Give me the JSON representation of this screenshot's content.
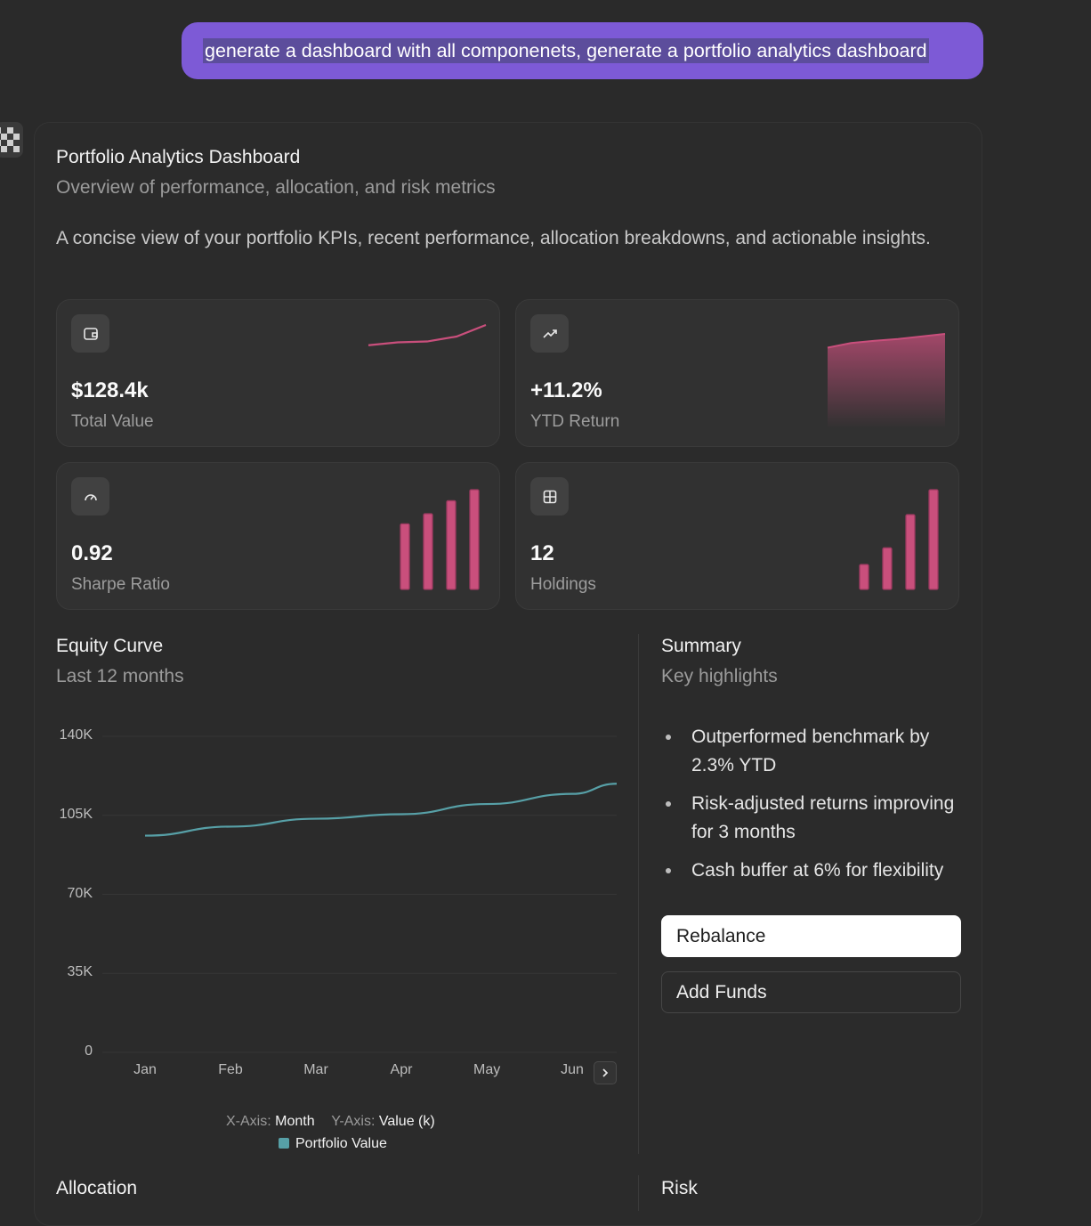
{
  "chat": {
    "user_message": "generate a dashboard with all componenets, generate a portfolio analytics dashboard"
  },
  "dashboard": {
    "title": "Portfolio Analytics Dashboard",
    "subtitle": "Overview of performance, allocation, and risk metrics",
    "description": "A concise view of your portfolio KPIs, recent performance, allocation breakdowns, and actionable insights.",
    "kpis": [
      {
        "value": "$128.4k",
        "label": "Total Value",
        "icon": "wallet-icon",
        "spark_type": "line",
        "spark": [
          1,
          2,
          2.3,
          4,
          8
        ]
      },
      {
        "value": "+11.2%",
        "label": "YTD Return",
        "icon": "trending-up-icon",
        "spark_type": "area",
        "spark": [
          5.5,
          6.8,
          7.4,
          7.9,
          8.6,
          9.3
        ]
      },
      {
        "value": "0.92",
        "label": "Sharpe Ratio",
        "icon": "gauge-icon",
        "spark_type": "bar",
        "spark": [
          0.71,
          0.82,
          0.96,
          1.08
        ]
      },
      {
        "value": "12",
        "label": "Holdings",
        "icon": "grid-icon",
        "spark_type": "bar",
        "spark": [
          3,
          5,
          9,
          12
        ]
      }
    ],
    "accent_color": "#c94f7c",
    "line_color": "#57a0a7"
  },
  "equity": {
    "title": "Equity Curve",
    "subtitle": "Last 12 months",
    "legend_x_key": "X-Axis:",
    "legend_x_val": "Month",
    "legend_y_key": "Y-Axis:",
    "legend_y_val": "Value (k)",
    "series_name": "Portfolio Value"
  },
  "chart_data": {
    "type": "line",
    "categories": [
      "Jan",
      "Feb",
      "Mar",
      "Apr",
      "May",
      "Jun"
    ],
    "series": [
      {
        "name": "Portfolio Value",
        "values": [
          96000,
          100000,
          103500,
          105500,
          110000,
          114500,
          119000
        ]
      }
    ],
    "ylim": [
      0,
      140000
    ],
    "yticks": [
      "140K",
      "105K",
      "70K",
      "35K",
      "0"
    ],
    "ytick_values": [
      140000,
      105000,
      70000,
      35000,
      0
    ],
    "grid": true,
    "legend_position": "bottom"
  },
  "summary": {
    "title": "Summary",
    "subtitle": "Key highlights",
    "items": [
      "Outperformed benchmark by 2.3% YTD",
      "Risk-adjusted returns improving for 3 months",
      "Cash buffer at 6% for flexibility"
    ],
    "primary_button": "Rebalance",
    "secondary_button": "Add Funds"
  },
  "bottom": {
    "allocation_title": "Allocation",
    "risk_title": "Risk"
  }
}
